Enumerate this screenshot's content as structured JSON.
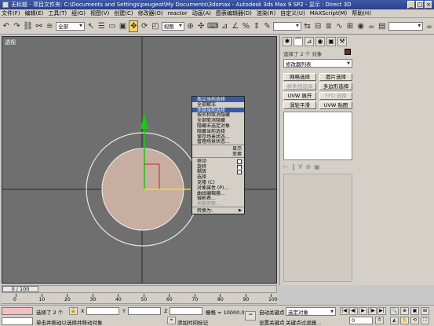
{
  "window": {
    "title": "无标题   - 项目文件夹: C:\\Documents and Settings\\peugeot\\My Documents\\3dsmax    - Autodesk 3ds Max 9 SP2    - 显示 : Direct 3D",
    "buttons": [
      "_",
      "□",
      "×"
    ]
  },
  "menu": [
    "文件(F)",
    "编辑(E)",
    "工具(T)",
    "组(G)",
    "视图(V)",
    "创建(C)",
    "修改器(O)",
    "reactor",
    "动画(A)",
    "图表编辑器(D)",
    "渲染(R)",
    "自定义(U)",
    "MAXScript(M)",
    "帮助(H)"
  ],
  "toolbar": {
    "selection_filter": "全部",
    "ref_coord": "视图",
    "named_selection": ""
  },
  "viewport": {
    "label": "透视",
    "quad_menu": [
      {
        "label": "孤立当前选择",
        "style": "hl"
      },
      {
        "label": "全部解冻",
        "style": ""
      },
      {
        "label": "冻结当前选择",
        "style": "hl"
      },
      {
        "label": "按名称取消隐藏",
        "style": ""
      },
      {
        "label": "全部取消隐藏",
        "style": ""
      },
      {
        "label": "隐藏未选定对象",
        "style": ""
      },
      {
        "label": "隐藏当前选择",
        "style": ""
      },
      {
        "label": "保存场景状态...",
        "style": ""
      },
      {
        "label": "管理场景状态...",
        "style": ""
      },
      {
        "label": "sep",
        "style": "sep"
      },
      {
        "label": "显示",
        "style": "right"
      },
      {
        "label": "变换",
        "style": "right"
      },
      {
        "label": "sep",
        "style": "sep"
      },
      {
        "label": "移动",
        "style": "boxed"
      },
      {
        "label": "旋转",
        "style": "boxed"
      },
      {
        "label": "缩放",
        "style": "boxed"
      },
      {
        "label": "选择",
        "style": ""
      },
      {
        "label": "克隆 (C)",
        "style": ""
      },
      {
        "label": "对象属性 (P)...",
        "style": ""
      },
      {
        "label": "曲线编辑器...",
        "style": ""
      },
      {
        "label": "摄影表...",
        "style": ""
      },
      {
        "label": "关联参数...",
        "style": "dis"
      },
      {
        "label": "sep",
        "style": "sep"
      },
      {
        "label": "转换为:",
        "style": "arrow"
      }
    ]
  },
  "command_panel": {
    "tabs": [
      "create-icon",
      "modify-icon",
      "hierarchy-icon",
      "motion-icon",
      "display-icon",
      "utilities-icon"
    ],
    "selection_info": "选择了 2 个 对象",
    "modifier_list": "修改器列表",
    "modifier_buttons": [
      {
        "label": "网格选择",
        "disabled": false
      },
      {
        "label": "面片选择",
        "disabled": false
      },
      {
        "label": "样条线选择",
        "disabled": true
      },
      {
        "label": "多边形选择",
        "disabled": false
      },
      {
        "label": "UVW 展开",
        "disabled": false
      },
      {
        "label": "FFD 选择",
        "disabled": true
      },
      {
        "label": "涡轮平滑",
        "disabled": false
      },
      {
        "label": "UVW 贴图",
        "disabled": false
      }
    ],
    "stack_controls": [
      "⊢",
      "‖",
      "∀",
      "⊗",
      "▣"
    ]
  },
  "timeline": {
    "slider_text": "0 / 100",
    "ticks": [
      "0",
      "10",
      "20",
      "30",
      "40",
      "50",
      "60",
      "70",
      "80",
      "90",
      "100"
    ]
  },
  "status": {
    "selection": "选择了 2 个",
    "x_label": "X",
    "y_label": "Y",
    "z_label": "Z",
    "grid": "栅格 = 10000.0mm",
    "auto_key": "自动关键点",
    "set_key": "设置关键点",
    "key_filter_combo": "选定对象",
    "key_filters": "关键点过滤器...",
    "frame": "0",
    "prompt": "单击并拖动以选择并移动对象",
    "add_time_tag": "添加时间标记",
    "playback": [
      "|◀",
      "◀|",
      "▶",
      "|▶",
      "▶|"
    ]
  },
  "colors": {
    "viewport_bg": "#6f6f6f",
    "sphere_fill": "#c8aea0",
    "ring": "#e8e8e8",
    "gizmo_y": "#20c020",
    "gizmo_x": "#d02020",
    "gizmo_z": "#e8e020",
    "highlight": "#3a5aa0"
  }
}
